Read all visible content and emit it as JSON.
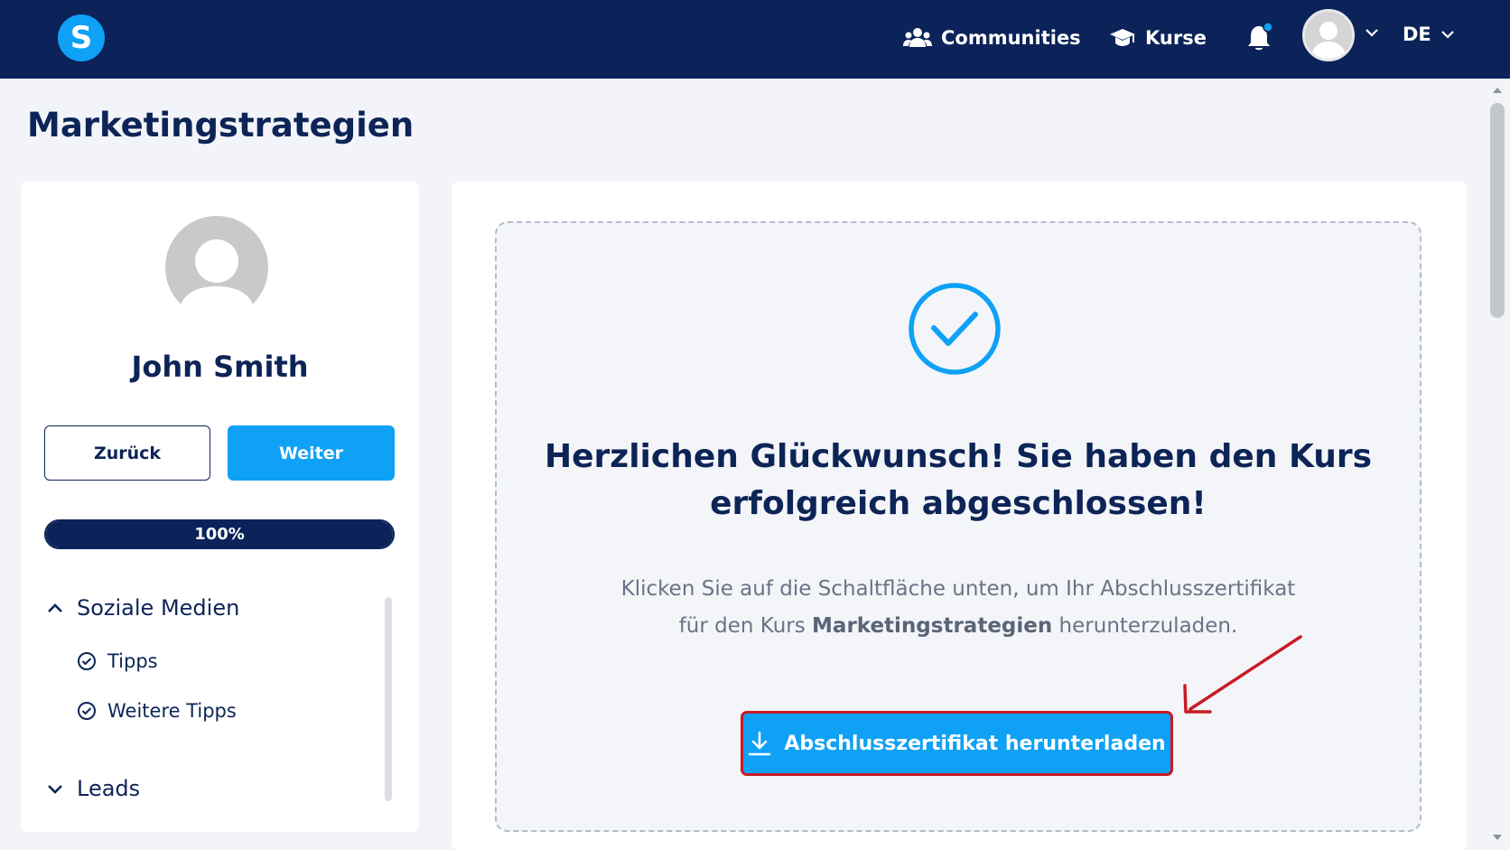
{
  "topbar": {
    "logo_letter": "S",
    "nav": [
      {
        "label": "Communities",
        "icon": "users-icon"
      },
      {
        "label": "Kurse",
        "icon": "graduation-cap-icon"
      }
    ],
    "notification_icon": "bell-icon",
    "language": "DE",
    "colors": {
      "background": "#0b2359",
      "accent": "#0ea1f5"
    }
  },
  "page": {
    "title": "Marketingstrategien"
  },
  "sidebar": {
    "user_name": "John Smith",
    "back_label": "Zurück",
    "next_label": "Weiter",
    "progress_label": "100%",
    "progress_value": 1.0,
    "sections": [
      {
        "title": "Soziale Medien",
        "expanded": true,
        "lessons": [
          {
            "label": "Tipps",
            "completed": true
          },
          {
            "label": "Weitere Tipps",
            "completed": true
          }
        ]
      },
      {
        "title": "Leads",
        "expanded": false,
        "lessons": []
      }
    ]
  },
  "completion": {
    "headline_line1": "Herzlichen Glückwunsch! Sie haben den Kurs",
    "headline_line2": "erfolgreich abgeschlossen!",
    "text_line1": "Klicken Sie auf die Schaltfläche unten, um Ihr Abschlusszertifikat",
    "text_prefix": "für den Kurs ",
    "course_name": "Marketingstrategien",
    "text_suffix": " herunterzuladen.",
    "download_label": "Abschlusszertifikat herunterladen",
    "download_icon": "download-icon",
    "annotation_color": "#c91a25"
  }
}
